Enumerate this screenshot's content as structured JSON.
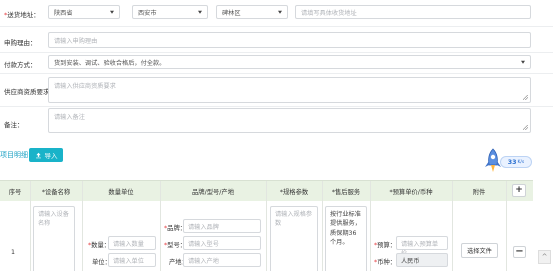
{
  "form": {
    "delivery_address": {
      "label_req": "*",
      "label": "送货地址：",
      "province": "陕西省",
      "city": "西安市",
      "district": "碑林区",
      "detail_placeholder": "请填写具体收货地址"
    },
    "reason": {
      "label": "申购理由：",
      "placeholder": "请输入申购理由"
    },
    "payment": {
      "label": "付款方式：",
      "value": "货到安装、调试、验收合格后，付全款。"
    },
    "supplier_req": {
      "label": "供应商资质要求",
      "placeholder": "请输入供应商资质要求"
    },
    "remarks": {
      "label": "备注：",
      "placeholder": "请输入备注"
    }
  },
  "items": {
    "section_title": "项目明细",
    "import_label": "导入",
    "headers": {
      "index": "序号",
      "device_name": "*设备名称",
      "qty_unit": "数量单位",
      "brand_model": "品牌/型号/产地",
      "spec": "*规格参数",
      "after_sales": "*售后服务",
      "budget_currency": "*预算单价/币种",
      "attachment": "附件"
    },
    "add_btn": "+",
    "row": {
      "index": "1",
      "device_name_placeholder": "请输入设备名称",
      "qty_label_req": "*",
      "qty_label": "数量：",
      "qty_placeholder": "请输入数量",
      "unit_label": "单位：",
      "unit_placeholder": "请输入单位",
      "brand_label": "品牌：",
      "brand_placeholder": "请输入品牌",
      "model_label": "型号：",
      "model_placeholder": "请输入型号",
      "origin_label": "产地：",
      "origin_placeholder": "请输入产地",
      "spec_placeholder": "请输入规格参数",
      "after_sales_value": "按行业标准提供服务，质保期36个月。",
      "budget_label_req": "*",
      "budget_label": "预算：",
      "budget_placeholder": "请输入预算单价",
      "currency_label_req": "*",
      "currency_label": "币种：",
      "currency_value": "人民币",
      "file_btn": "选择文件",
      "remove_btn": "−"
    }
  },
  "widget": {
    "value": "33",
    "unit": "K/s"
  },
  "scroll_top": "^",
  "colors": {
    "accent": "#19b3c9",
    "required": "#e4393c",
    "header_bg": "#e9f2e3"
  }
}
